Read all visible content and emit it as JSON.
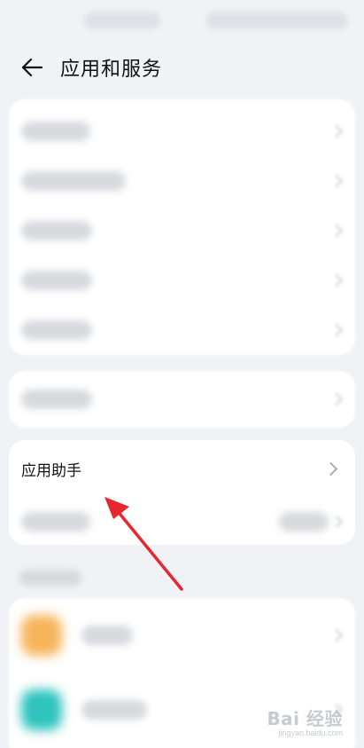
{
  "header": {
    "title": "应用和服务"
  },
  "app_helper_card": {
    "label": "应用助手"
  },
  "icons": {
    "back": "back-arrow-icon",
    "chevron": "chevron-right-icon"
  },
  "colors": {
    "background": "#f1f2f6",
    "card": "#ffffff",
    "arrow": "#e8262d"
  },
  "watermark": {
    "main": "Bai 经验",
    "sub": "jingyan.baidu.com"
  }
}
